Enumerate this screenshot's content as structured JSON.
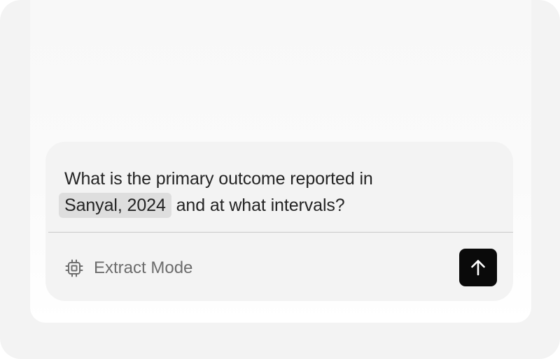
{
  "composer": {
    "query_line1": "What is the primary outcome reported in",
    "citation": "Sanyal, 2024",
    "query_line2_rest": " and at what intervals?",
    "mode_label": "Extract Mode",
    "mode_icon": "cpu-chip-icon",
    "send_icon": "arrow-up-icon"
  },
  "colors": {
    "send_button_bg": "#0a0a0a",
    "citation_chip_bg": "#dedede",
    "composer_bg": "#f3f3f3"
  }
}
